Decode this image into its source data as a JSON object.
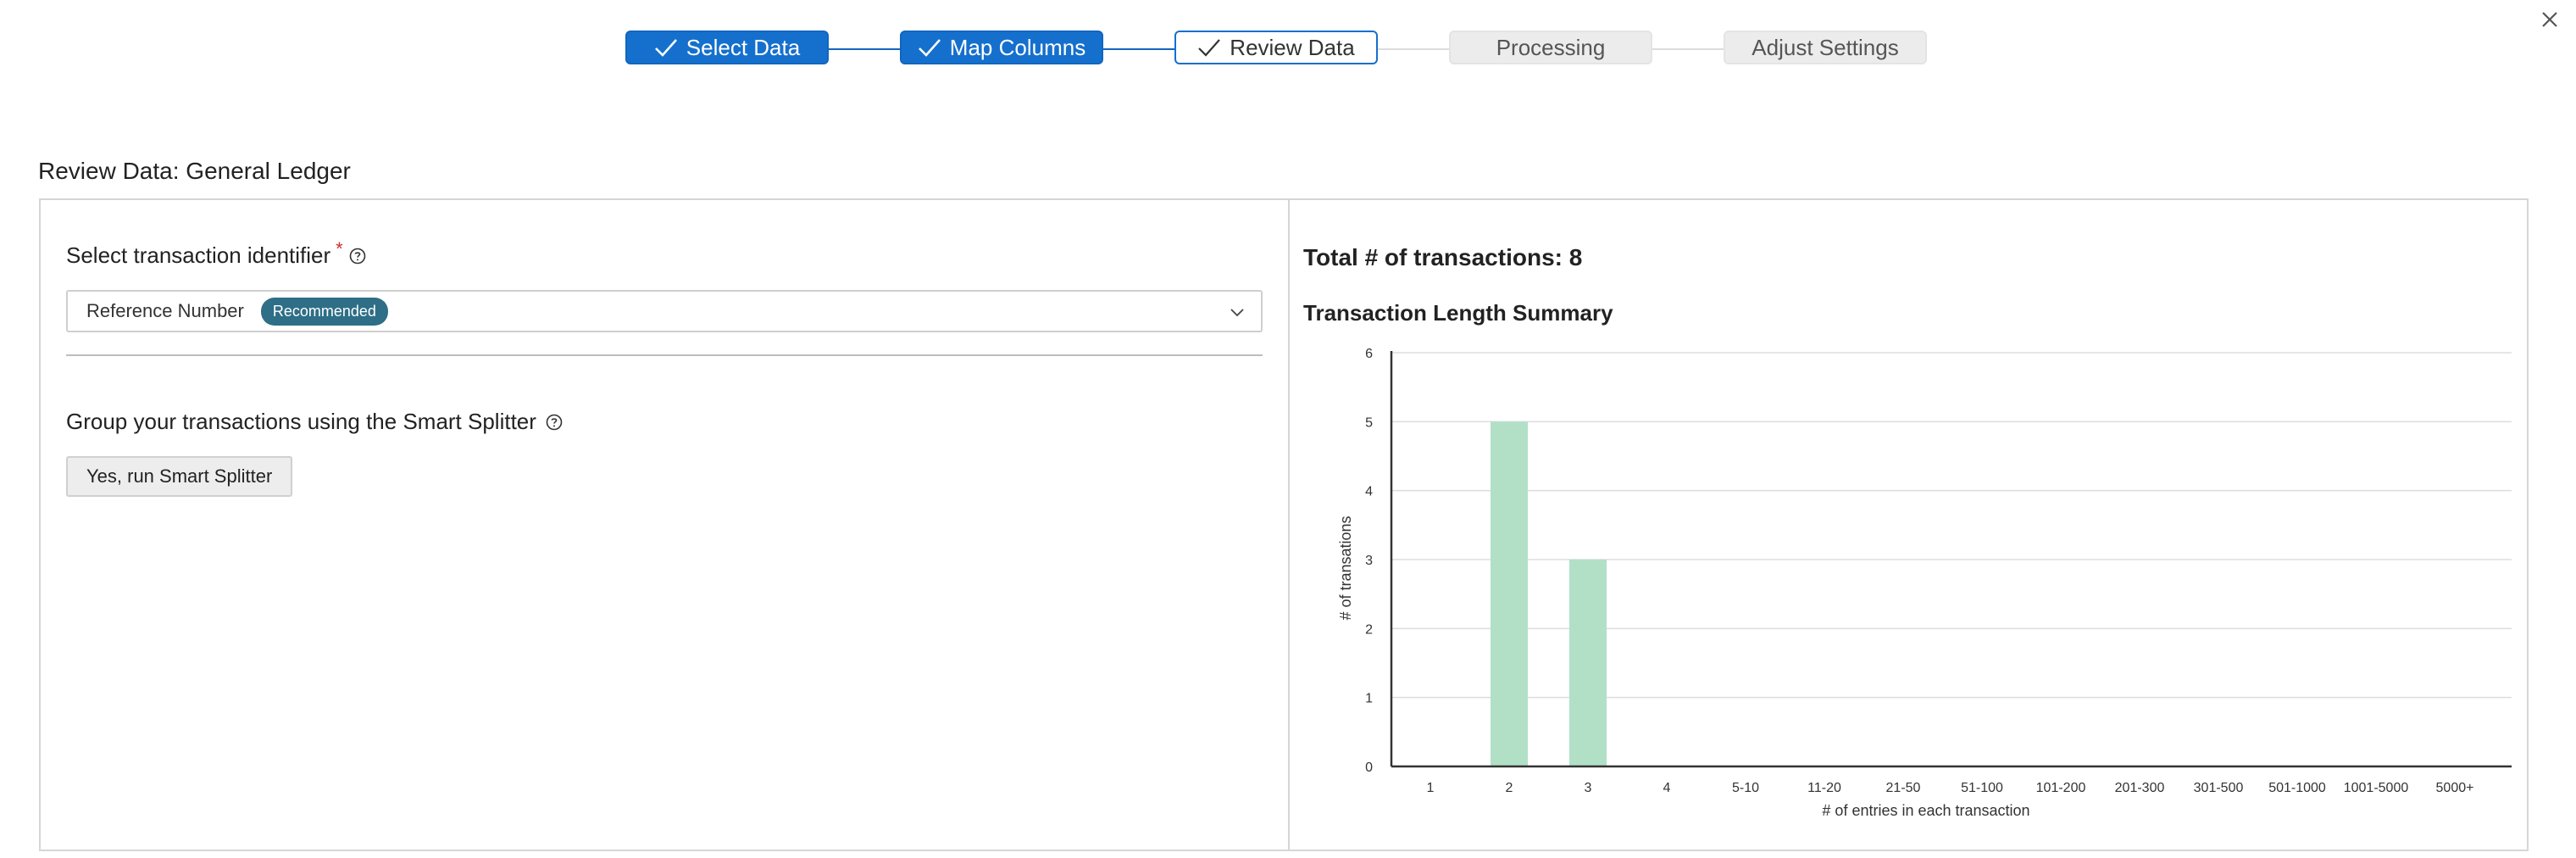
{
  "stepper": {
    "steps": [
      {
        "label": "Select Data",
        "state": "done"
      },
      {
        "label": "Map Columns",
        "state": "done"
      },
      {
        "label": "Review Data",
        "state": "current"
      },
      {
        "label": "Processing",
        "state": "pending"
      },
      {
        "label": "Adjust Settings",
        "state": "pending"
      }
    ]
  },
  "page": {
    "title": "Review Data: General Ledger"
  },
  "left": {
    "identifier_label": "Select transaction identifier",
    "required_mark": "*",
    "selected_value": "Reference Number",
    "badge": "Recommended",
    "group_label": "Group your transactions using the Smart Splitter",
    "smart_button": "Yes, run Smart Splitter"
  },
  "right": {
    "total_text": "Total # of transactions: 8",
    "chart_heading": "Transaction Length Summary"
  },
  "colors": {
    "primary": "#1570cd",
    "bar": "#b2e0c6",
    "badge": "#2e6e86",
    "required": "#d32f2f"
  },
  "icons": {
    "close": "close-icon",
    "help": "help-icon",
    "check": "check-icon",
    "dropdown": "chevron-down-icon"
  },
  "chart_data": {
    "type": "bar",
    "title": "Transaction Length Summary",
    "xlabel": "# of entries in each transaction",
    "ylabel": "# of transations",
    "categories": [
      "1",
      "2",
      "3",
      "4",
      "5-10",
      "11-20",
      "21-50",
      "51-100",
      "101-200",
      "201-300",
      "301-500",
      "501-1000",
      "1001-5000",
      "5000+"
    ],
    "values": [
      0,
      5,
      3,
      0,
      0,
      0,
      0,
      0,
      0,
      0,
      0,
      0,
      0,
      0
    ],
    "ylim": [
      0,
      6
    ],
    "yticks": [
      0,
      1,
      2,
      3,
      4,
      5,
      6
    ],
    "grid": true,
    "legend": "none"
  }
}
